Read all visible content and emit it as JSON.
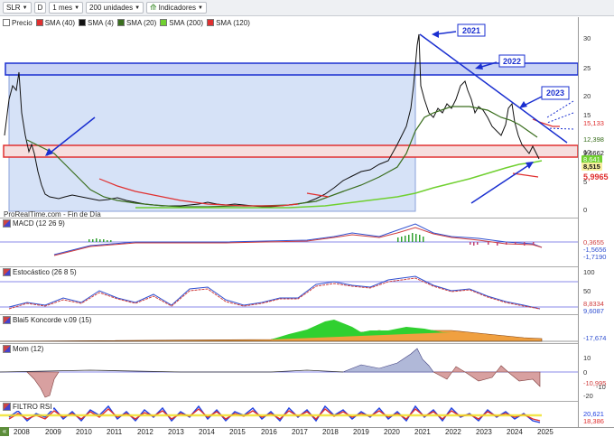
{
  "toolbar": {
    "symbol": "SLR",
    "period_letter": "D",
    "timeframe": "1 mes",
    "units": "200 unidades",
    "indicators": "Indicadores"
  },
  "legend": [
    {
      "label": "Precio",
      "color": "#ffffff"
    },
    {
      "label": "SMA (40)",
      "color": "#e03030"
    },
    {
      "label": "SMA (4)",
      "color": "#111111"
    },
    {
      "label": "SMA (20)",
      "color": "#3a6e1e"
    },
    {
      "label": "SMA (200)",
      "color": "#70d030"
    },
    {
      "label": "SMA (120)",
      "color": "#e03030"
    }
  ],
  "annotations": {
    "y2021": "2021",
    "y2022": "2022",
    "y2023": "2023",
    "watermark": "ProRealTime.com - Fin de Día"
  },
  "panels": {
    "macd": "MACD (12 26 9)",
    "stoch": "Estocástico (26 8 5)",
    "koncorde": "Blai5 Koncorde v.09 (15)",
    "mom": "Mom (12)",
    "rsi": "FILTRO RSI"
  },
  "price_axis": {
    "ticks": [
      "30",
      "25",
      "20",
      "15",
      "10",
      "5",
      "0"
    ],
    "tags": {
      "sma40": "15,133",
      "sma20": "12,398",
      "sma4": "9,6662",
      "sma200": "8,515",
      "sma120": "5,9965",
      "price": "8,641"
    }
  },
  "macd_axis": {
    "tags": [
      "0,3655",
      "-1,5656",
      "-1,7190"
    ]
  },
  "stoch_axis": {
    "ticks": [
      "100",
      "50"
    ],
    "tags": [
      "8,8334",
      "9,6087"
    ]
  },
  "koncorde_axis": {
    "tags": [
      "-17,674"
    ]
  },
  "mom_axis": {
    "ticks": [
      "10",
      "0",
      "-10",
      "-20"
    ],
    "tags": [
      "-10,995"
    ]
  },
  "rsi_axis": {
    "tags": [
      "20,621",
      "18,386"
    ]
  },
  "years": [
    "2008",
    "2009",
    "2010",
    "2011",
    "2012",
    "2013",
    "2014",
    "2015",
    "2016",
    "2017",
    "2018",
    "2019",
    "2020",
    "2021",
    "2022",
    "2023",
    "2024",
    "2025"
  ],
  "colors": {
    "accent": "#1a2fd0",
    "box_red": "#e03030",
    "box_blue": "#c9d8f5"
  }
}
